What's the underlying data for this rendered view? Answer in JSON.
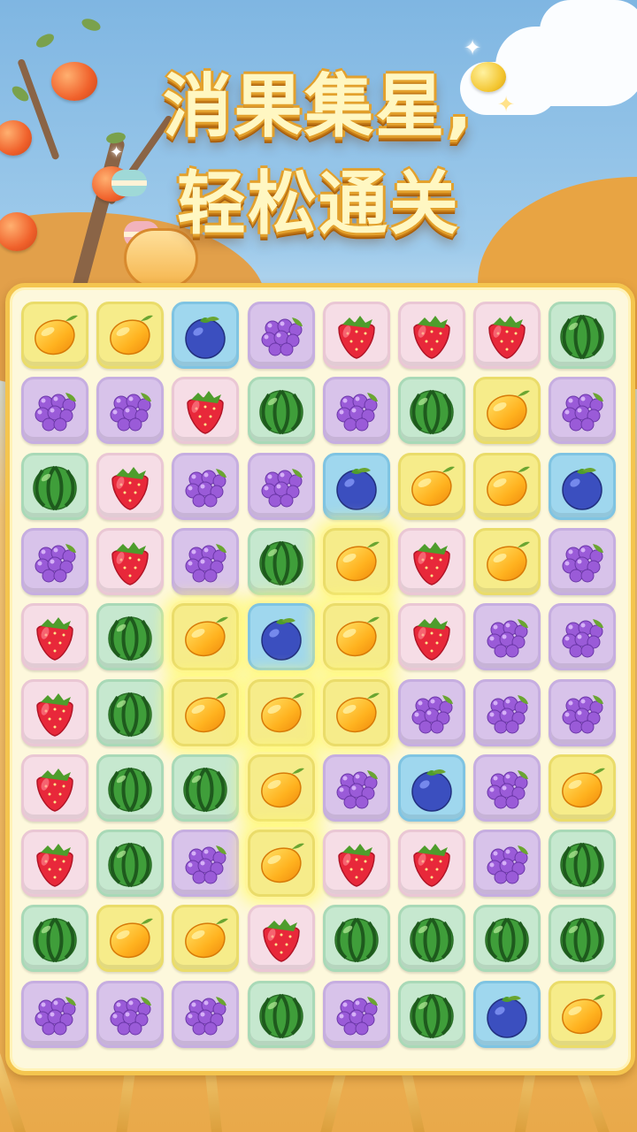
{
  "title": {
    "line1": "消果集星,",
    "line2": "轻松通关"
  },
  "board": {
    "rows": [
      [
        "mango",
        "mango",
        "blueberry",
        "grape",
        "strawberry",
        "strawberry",
        "strawberry",
        "watermelon"
      ],
      [
        "grape",
        "grape",
        "strawberry",
        "watermelon",
        "grape",
        "watermelon",
        "mango",
        "grape"
      ],
      [
        "watermelon",
        "strawberry",
        "grape",
        "grape",
        "blueberry",
        "mango",
        "mango",
        "blueberry"
      ],
      [
        "grape",
        "strawberry",
        "grape",
        "watermelon",
        "mango",
        "strawberry",
        "mango",
        "grape"
      ],
      [
        "strawberry",
        "watermelon",
        "mango",
        "blueberry",
        "mango",
        "strawberry",
        "grape",
        "grape"
      ],
      [
        "strawberry",
        "watermelon",
        "mango",
        "mango",
        "mango",
        "grape",
        "grape",
        "grape"
      ],
      [
        "strawberry",
        "watermelon",
        "watermelon",
        "mango",
        "grape",
        "blueberry",
        "grape",
        "mango"
      ],
      [
        "strawberry",
        "watermelon",
        "grape",
        "mango",
        "strawberry",
        "strawberry",
        "grape",
        "watermelon"
      ],
      [
        "watermelon",
        "mango",
        "mango",
        "strawberry",
        "watermelon",
        "watermelon",
        "watermelon",
        "watermelon"
      ],
      [
        "grape",
        "grape",
        "grape",
        "watermelon",
        "grape",
        "watermelon",
        "blueberry",
        "mango"
      ]
    ],
    "highlighted": [
      [
        3,
        4
      ],
      [
        4,
        2
      ],
      [
        4,
        3
      ],
      [
        4,
        4
      ],
      [
        5,
        2
      ],
      [
        5,
        3
      ],
      [
        5,
        4
      ],
      [
        6,
        3
      ],
      [
        7,
        3
      ]
    ]
  }
}
